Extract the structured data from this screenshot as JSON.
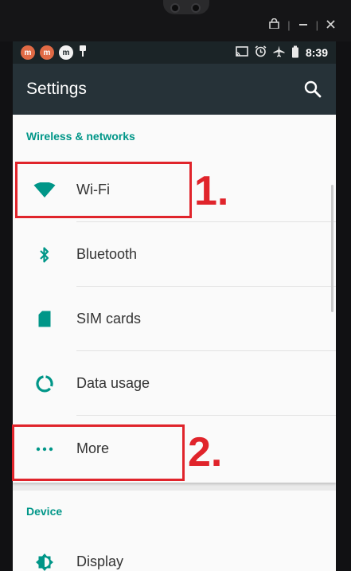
{
  "colors": {
    "accent": "#009688",
    "toolbar": "#263238",
    "status_bar": "#1b2427",
    "annotation": "#e0242b"
  },
  "status_bar": {
    "notifications": [
      "m",
      "m",
      "m"
    ],
    "notification_icons": [
      "app-m-icon",
      "app-m-icon",
      "app-m-white-icon",
      "usb-icon"
    ],
    "right_icons": [
      "cast-icon",
      "alarm-icon",
      "airplane-icon",
      "battery-icon"
    ],
    "time": "8:39"
  },
  "toolbar": {
    "title": "Settings",
    "search_icon": "search-icon"
  },
  "sections": [
    {
      "header": "Wireless & networks",
      "items": [
        {
          "label": "Wi-Fi",
          "icon": "wifi-icon"
        },
        {
          "label": "Bluetooth",
          "icon": "bluetooth-icon"
        },
        {
          "label": "SIM cards",
          "icon": "sim-card-icon"
        },
        {
          "label": "Data usage",
          "icon": "data-usage-icon"
        },
        {
          "label": "More",
          "icon": "more-icon"
        }
      ]
    },
    {
      "header": "Device",
      "items": [
        {
          "label": "Display",
          "icon": "display-icon"
        }
      ]
    }
  ],
  "annotations": [
    {
      "label": "1.",
      "target": "Wi-Fi"
    },
    {
      "label": "2.",
      "target": "More"
    }
  ]
}
